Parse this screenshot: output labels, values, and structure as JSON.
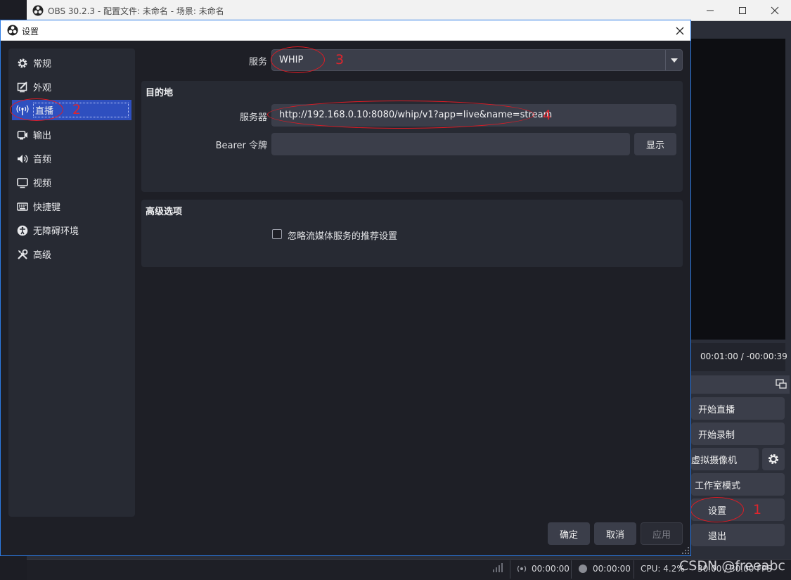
{
  "main_window": {
    "title": "OBS 30.2.3 - 配置文件: 未命名 - 场景: 未命名",
    "timer": "00:01:00  /  -00:00:39",
    "controls": [
      "开始直播",
      "开始录制",
      "虚拟摄像机",
      "工作室模式",
      "设置",
      "退出"
    ],
    "status": {
      "stream_time": "00:00:00",
      "record_time": "00:00:00",
      "cpu": "CPU: 4.2%",
      "fps": "30.00 / 30.00 FPS"
    }
  },
  "dialog": {
    "title": "设置",
    "sidebar": [
      {
        "label": "常规",
        "icon": "gear-icon"
      },
      {
        "label": "外观",
        "icon": "appearance-icon"
      },
      {
        "label": "直播",
        "icon": "antenna-icon",
        "selected": true
      },
      {
        "label": "输出",
        "icon": "output-icon"
      },
      {
        "label": "音频",
        "icon": "speaker-icon"
      },
      {
        "label": "视频",
        "icon": "monitor-icon"
      },
      {
        "label": "快捷键",
        "icon": "keyboard-icon"
      },
      {
        "label": "无障碍环境",
        "icon": "accessibility-icon"
      },
      {
        "label": "高级",
        "icon": "tools-icon"
      }
    ],
    "service": {
      "label": "服务",
      "value": "WHIP"
    },
    "destination": {
      "title": "目的地",
      "server_label": "服务器",
      "server_value": "http://192.168.0.10:8080/whip/v1?app=live&name=stream",
      "bearer_label": "Bearer 令牌",
      "bearer_value": "",
      "show_button": "显示"
    },
    "advanced": {
      "title": "高级选项",
      "checkbox_label": "忽略流媒体服务的推荐设置",
      "checked": false
    },
    "buttons": {
      "ok": "确定",
      "cancel": "取消",
      "apply": "应用"
    }
  },
  "annotations": [
    "1",
    "2",
    "3",
    "4"
  ],
  "watermark": "CSDN @freeabc",
  "colors": {
    "accent": "#2e4fbf",
    "annotation": "#e01b24",
    "panel": "#272a33",
    "input": "#3b3e4a"
  }
}
